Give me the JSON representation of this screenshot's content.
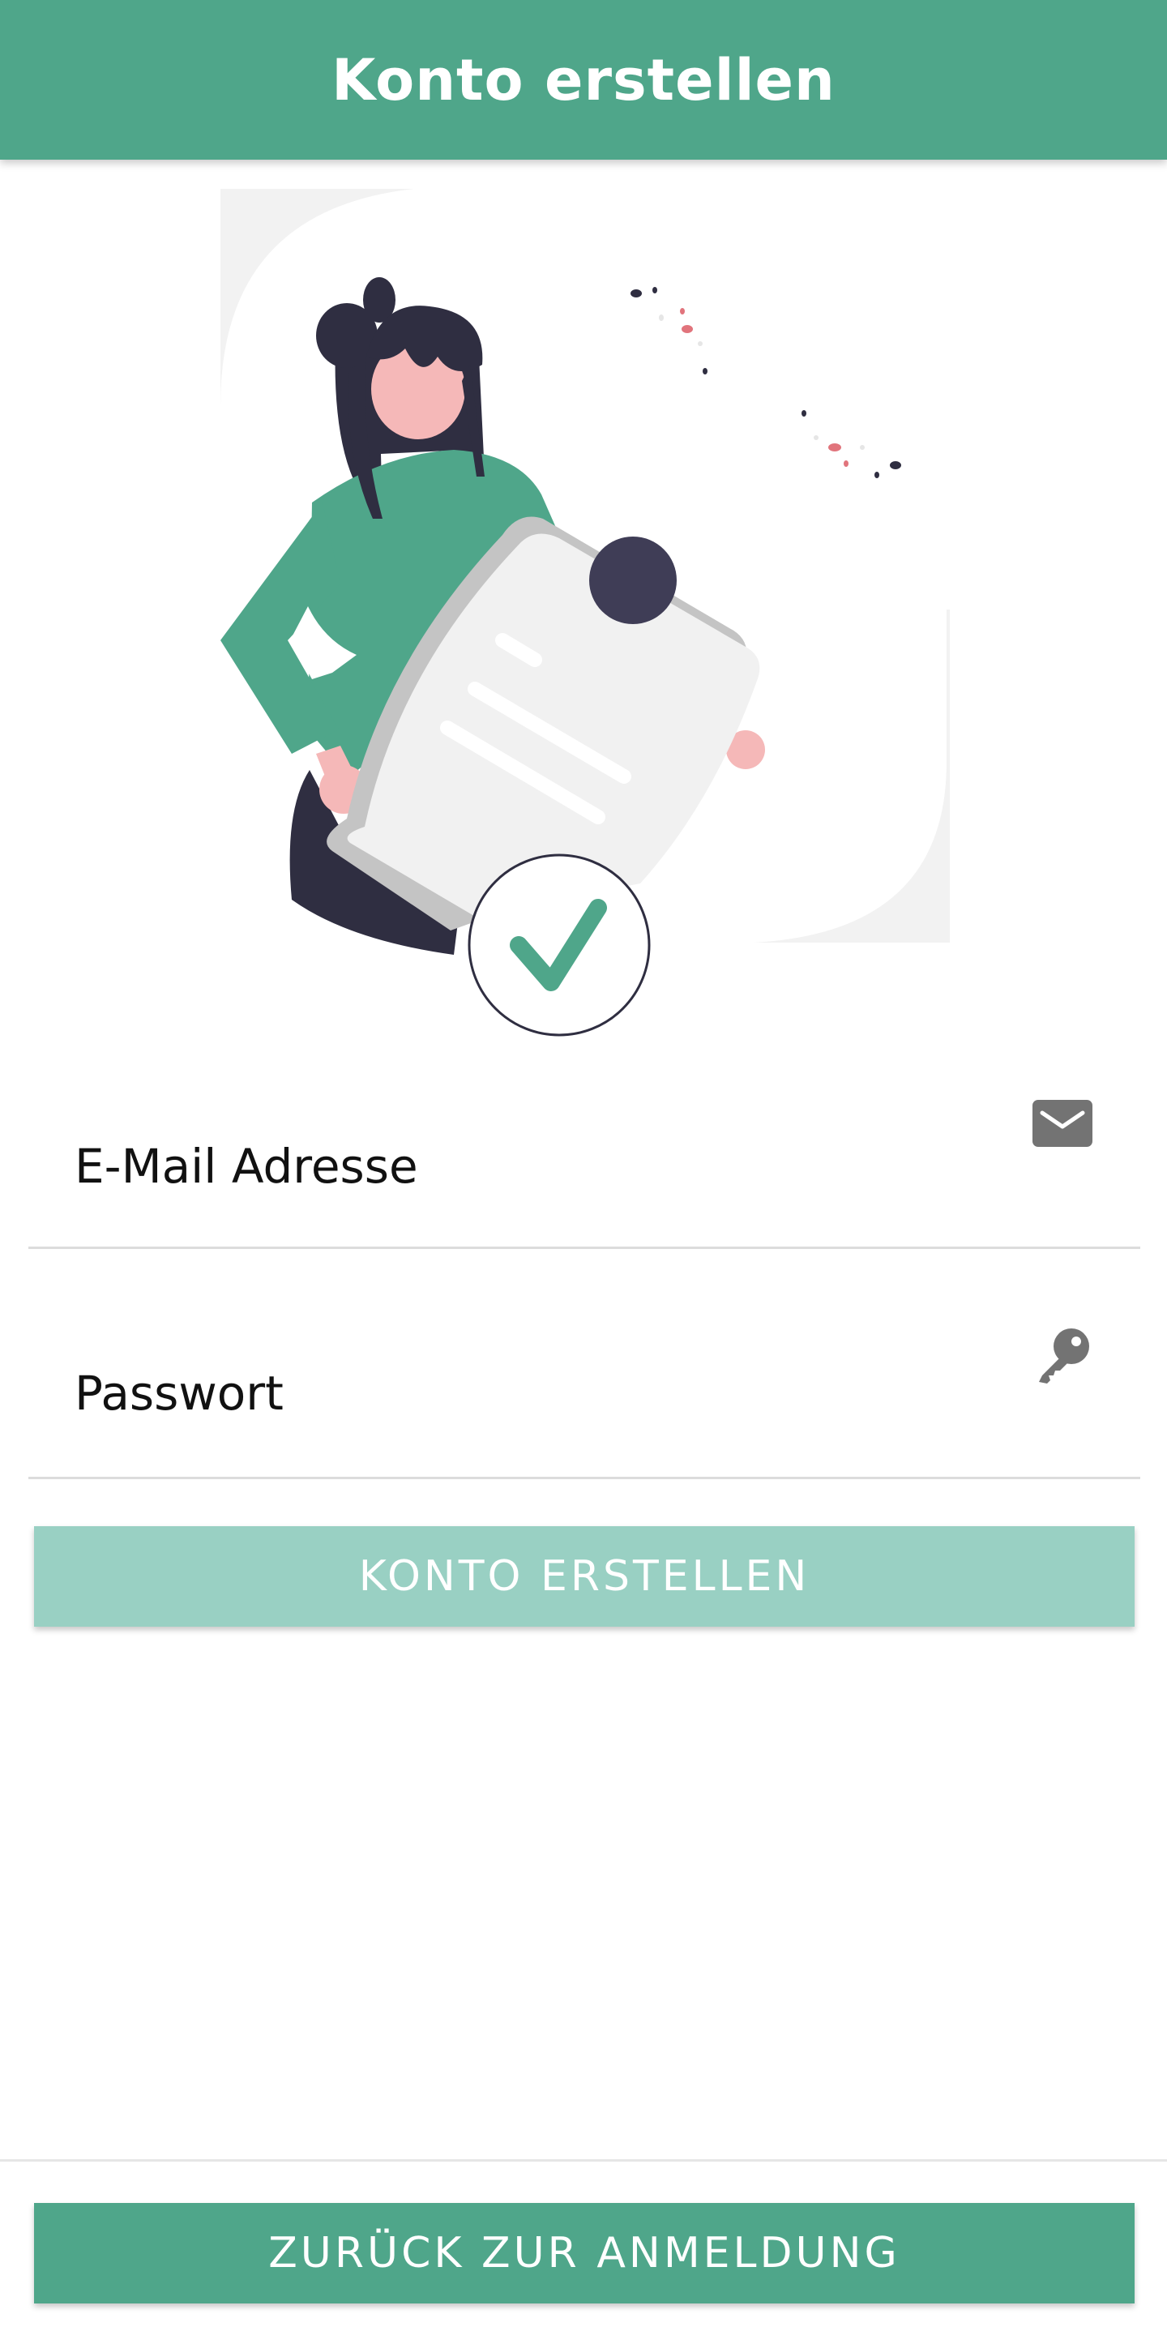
{
  "header": {
    "title": "Konto erstellen"
  },
  "illustration": {
    "name": "account-created-illustration",
    "colors": {
      "primary": "#4fa68a",
      "dark": "#2f2e41",
      "skin": "#f5b8b8",
      "paper": "#f1f1f1",
      "paper_shadow": "#c4c4c4",
      "background_shape": "#f2f2f2",
      "accent_dot": "#e1747c"
    }
  },
  "form": {
    "email": {
      "label": "E-Mail Adresse",
      "icon": "envelope-icon"
    },
    "password": {
      "label": "Passwort",
      "icon": "key-icon"
    },
    "submit_label": "KONTO ERSTELLEN"
  },
  "footer": {
    "back_label": "ZURÜCK ZUR ANMELDUNG"
  },
  "colors": {
    "accent": "#4fa68a",
    "button_disabled": "#99d0c3",
    "divider": "#dcdcdc",
    "icon_gray": "#737373"
  }
}
